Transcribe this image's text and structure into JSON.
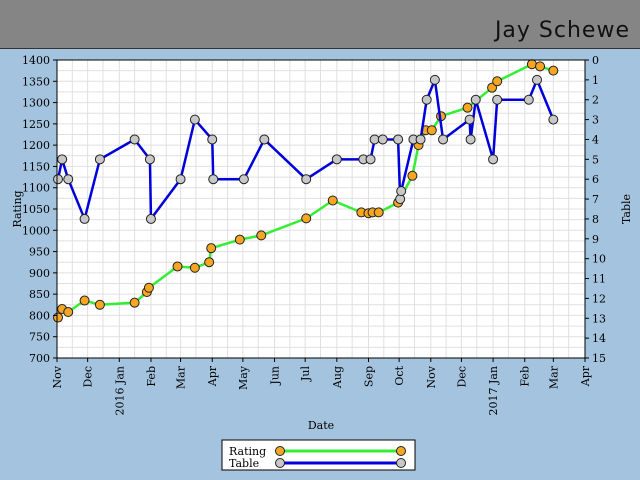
{
  "header": {
    "player_name": "Jay Schewe"
  },
  "colors": {
    "rating_line": "#33ee33",
    "rating_marker": "#f5a623",
    "table_line": "#0000dd",
    "table_marker": "#c8c8c8",
    "background": "#a4c3de",
    "plot_bg": "#ffffff",
    "grid": "#e0e0e0"
  },
  "chart_data": {
    "type": "line",
    "xlabel": "Date",
    "ylabel_left": "Rating",
    "ylabel_right": "Table",
    "x_range": [
      "2015-11-01",
      "2017-04-01"
    ],
    "y_left_range": [
      700,
      1400
    ],
    "y_left_ticks": [
      700,
      750,
      800,
      850,
      900,
      950,
      1000,
      1050,
      1100,
      1150,
      1200,
      1250,
      1300,
      1350,
      1400
    ],
    "y_right_range": [
      15,
      0
    ],
    "y_right_ticks": [
      0,
      1,
      2,
      3,
      4,
      5,
      6,
      7,
      8,
      9,
      10,
      11,
      12,
      13,
      14,
      15
    ],
    "x_tick_labels": [
      "Nov",
      "Dec",
      "2016 Jan",
      "Feb",
      "Mar",
      "Apr",
      "May",
      "Jun",
      "Jul",
      "Aug",
      "Sep",
      "Oct",
      "Nov",
      "Dec",
      "2017 Jan",
      "Feb",
      "Mar",
      "Apr"
    ],
    "legend_position": "bottom-center",
    "grid": true,
    "series": [
      {
        "name": "Rating",
        "axis": "left",
        "x": [
          "2015-11-02",
          "2015-11-06",
          "2015-11-12",
          "2015-11-28",
          "2015-12-13",
          "2016-01-16",
          "2016-01-28",
          "2016-01-30",
          "2016-02-27",
          "2016-03-15",
          "2016-03-29",
          "2016-03-31",
          "2016-04-28",
          "2016-05-19",
          "2016-07-02",
          "2016-07-28",
          "2016-08-25",
          "2016-09-01",
          "2016-09-05",
          "2016-09-11",
          "2016-09-30",
          "2016-10-14",
          "2016-10-20",
          "2016-10-27",
          "2016-11-02",
          "2016-11-11",
          "2016-12-07",
          "2016-12-31",
          "2017-01-05",
          "2017-02-08",
          "2017-02-16",
          "2017-03-01"
        ],
        "values": [
          795,
          815,
          808,
          835,
          825,
          830,
          855,
          865,
          915,
          912,
          925,
          958,
          978,
          988,
          1028,
          1070,
          1042,
          1040,
          1042,
          1042,
          1065,
          1128,
          1200,
          1235,
          1235,
          1268,
          1288,
          1335,
          1350,
          1390,
          1385,
          1375
        ]
      },
      {
        "name": "Table",
        "axis": "right",
        "x": [
          "2015-11-02",
          "2015-11-06",
          "2015-11-12",
          "2015-11-28",
          "2015-12-13",
          "2016-01-16",
          "2016-01-31",
          "2016-02-01",
          "2016-03-01",
          "2016-03-15",
          "2016-04-01",
          "2016-04-02",
          "2016-05-02",
          "2016-05-22",
          "2016-07-02",
          "2016-08-01",
          "2016-08-27",
          "2016-09-03",
          "2016-09-07",
          "2016-09-15",
          "2016-09-30",
          "2016-10-02",
          "2016-10-03",
          "2016-10-15",
          "2016-10-22",
          "2016-10-28",
          "2016-11-05",
          "2016-11-13",
          "2016-12-09",
          "2016-12-10",
          "2016-12-15",
          "2017-01-01",
          "2017-01-05",
          "2017-02-05",
          "2017-02-13",
          "2017-03-01"
        ],
        "values": [
          6,
          5,
          6,
          8,
          5,
          4,
          5,
          8,
          6,
          3,
          4,
          6,
          6,
          4,
          6,
          5,
          5,
          5,
          4,
          4,
          4,
          7,
          6.6,
          4,
          4,
          2,
          1,
          4,
          3,
          4,
          2,
          5,
          2,
          2,
          1,
          3
        ]
      }
    ]
  }
}
